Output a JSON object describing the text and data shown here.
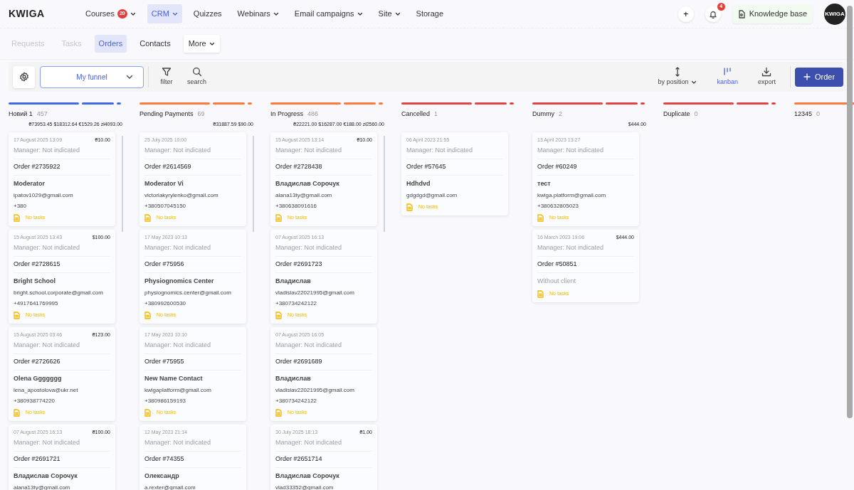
{
  "logo": "KWIGA",
  "nav": [
    {
      "label": "Courses",
      "badge": "20",
      "has_menu": true,
      "selected": false
    },
    {
      "label": "CRM",
      "has_menu": true,
      "selected": true
    },
    {
      "label": "Quizzes",
      "has_menu": false,
      "selected": false
    },
    {
      "label": "Webinars",
      "has_menu": true,
      "selected": false
    },
    {
      "label": "Email campaigns",
      "has_menu": true,
      "selected": false
    },
    {
      "label": "Site",
      "has_menu": true,
      "selected": false
    },
    {
      "label": "Storage",
      "has_menu": false,
      "selected": false
    }
  ],
  "header_right": {
    "add_button": "+",
    "notifications_badge": "4",
    "knowledge_base": "Knowledge base",
    "avatar_text": "KWIGA"
  },
  "subnav": [
    {
      "label": "Requests",
      "disabled": true,
      "selected": false
    },
    {
      "label": "Tasks",
      "disabled": true,
      "selected": false
    },
    {
      "label": "Orders",
      "disabled": false,
      "selected": true
    },
    {
      "label": "Contacts",
      "disabled": false,
      "selected": false
    }
  ],
  "subnav_more": "More",
  "toolbar": {
    "funnel": "My funnel",
    "tools": [
      {
        "label": "filter",
        "kind": "filter",
        "selected": false
      },
      {
        "label": "search",
        "kind": "search",
        "selected": false
      }
    ],
    "views": [
      {
        "label": "by position",
        "kind": "sort",
        "selected": false
      },
      {
        "label": "kanban",
        "kind": "kanban",
        "selected": true
      },
      {
        "label": "export",
        "kind": "export",
        "selected": false
      }
    ],
    "create_button": "Order"
  },
  "columns": [
    {
      "title": "Новий 1",
      "count": "457",
      "color": "#4169e1",
      "totals": "₴73953.45 $18312.64 €1529.26 zł4093.00",
      "cards": [
        {
          "date": "17 August 2025 13:09",
          "amount": "₴10.00",
          "manager": "Manager: Not indicated",
          "order": "Order #2735922",
          "kind": "contact",
          "client": "Moderator",
          "email": "ipatov1029@gmail.com",
          "phone": "+380",
          "tasks": "No tasks"
        },
        {
          "date": "15 August 2025 13:43",
          "amount": "$100.00",
          "manager": "Manager: Not indicated",
          "order": "Order #2728615",
          "kind": "contact",
          "client": "Bright School",
          "email": "bright.school.corporate@gmail.com",
          "phone": "+4917641769995",
          "tasks": "No tasks"
        },
        {
          "date": "15 August 2025 03:46",
          "amount": "₴123.00",
          "manager": "Manager: Not indicated",
          "order": "Order #2726626",
          "kind": "contact",
          "client": "Olena Ggggggg",
          "email": "lena_apostolova@ukr.net",
          "phone": "+380938774220",
          "tasks": "No tasks"
        },
        {
          "date": "07 August 2025 16:13",
          "amount": "₴100.00",
          "manager": "Manager: Not indicated",
          "order": "Order #2691721",
          "kind": "contact",
          "client": "Владислав Сорочук",
          "email": "alana13ty@gmail.com"
        }
      ]
    },
    {
      "title": "Pending Payments",
      "count": "69",
      "color": "#ff7a3d",
      "totals": "₴31887.59 $90.00",
      "cards": [
        {
          "date": "25 July 2025 10:00",
          "manager": "Manager: Not indicated",
          "order": "Order #2614569",
          "kind": "contact",
          "client": "Moderator Vi",
          "email": "victoriakyrylenko@gmail.com",
          "phone": "+380507045150",
          "tasks": "No tasks"
        },
        {
          "date": "17 May 2023 10:13",
          "manager": "Manager: Not indicated",
          "order": "Order #75956",
          "kind": "contact",
          "client": "Physiognomics Center",
          "email": "physiognomics.center@gmail.com",
          "phone": "+380992600530",
          "tasks": "No tasks"
        },
        {
          "date": "17 May 2023 10:10",
          "manager": "Manager: Not indicated",
          "order": "Order #75955",
          "kind": "contact",
          "client": "New Name Contact",
          "email": "kwigaplatform@gmail.com",
          "phone": "+380986159193",
          "tasks": "No tasks"
        },
        {
          "date": "12 May 2023 21:14",
          "manager": "Manager: Not indicated",
          "order": "Order #74355",
          "kind": "contact",
          "client": "Олександр",
          "email": "a.rexter@gmail.com"
        }
      ]
    },
    {
      "title": "In Progress",
      "count": "486",
      "color": "#ff7a3d",
      "totals": "₴22221.00 $16287.00 €188.00 zł2560.00",
      "cards": [
        {
          "date": "15 August 2025 13:14",
          "amount": "₴10.00",
          "manager": "Manager: Not indicated",
          "order": "Order #2728438",
          "kind": "contact",
          "client": "Владислав Сорочук",
          "email": "alana13ty@gmail.com",
          "phone": "+380638091616",
          "tasks": "No tasks"
        },
        {
          "date": "07 August 2025 16:13",
          "manager": "Manager: Not indicated",
          "order": "Order #2691723",
          "kind": "contact",
          "client": "Владислав",
          "email": "vladislav22021995@gmail.com",
          "phone": "+380734242122",
          "tasks": "No tasks"
        },
        {
          "date": "07 August 2025 16:05",
          "manager": "Manager: Not indicated",
          "order": "Order #2691689",
          "kind": "contact",
          "client": "Владислав",
          "email": "vladislav22021995@gmail.com",
          "phone": "+380734242122",
          "tasks": "No tasks"
        },
        {
          "date": "30 July 2025 18:13",
          "amount": "₴1.00",
          "manager": "Manager: Not indicated",
          "order": "Order #2651714",
          "kind": "contact",
          "client": "Владислав Сорочук",
          "email": "vlad33352@gmail.com"
        }
      ]
    },
    {
      "title": "Cancelled",
      "count": "1",
      "color": "#e04444",
      "cards": [
        {
          "date": "06 April 2023 21:55",
          "manager": "Manager: Not indicated",
          "order": "Order #57645",
          "kind": "contact",
          "client": "Hdhdvd",
          "email": "gdgdgd@gmail.com",
          "tasks": "No tasks"
        }
      ]
    },
    {
      "title": "Dummy",
      "count": "2",
      "color": "#e04444",
      "totals": "$444.00",
      "cards": [
        {
          "date": "13 April 2023 13:27",
          "manager": "Manager: Not indicated",
          "order": "Order #60249",
          "kind": "contact",
          "client": "тест",
          "email": "kwiga.platform@gmail.com",
          "phone": "+380632805023",
          "tasks": "No tasks"
        },
        {
          "date": "16 March 2023 19:06",
          "amount": "$444.00",
          "manager": "Manager: Not indicated",
          "order": "Order #50851",
          "kind": "no-client",
          "client": "Without client",
          "tasks": "No tasks"
        }
      ]
    },
    {
      "title": "Duplicate",
      "count": "0",
      "color": "#e04444"
    },
    {
      "title": "12345",
      "count": "0",
      "color": "#ff7a3d"
    }
  ]
}
